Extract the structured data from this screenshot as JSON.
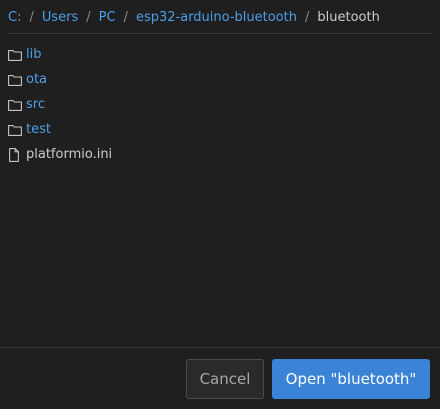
{
  "breadcrumb": {
    "segments": [
      {
        "label": "C:"
      },
      {
        "label": "Users"
      },
      {
        "label": "PC"
      },
      {
        "label": "esp32-arduino-bluetooth"
      },
      {
        "label": "bluetooth"
      }
    ],
    "separator": "/"
  },
  "entries": [
    {
      "name": "lib",
      "type": "folder"
    },
    {
      "name": "ota",
      "type": "folder"
    },
    {
      "name": "src",
      "type": "folder"
    },
    {
      "name": "test",
      "type": "folder"
    },
    {
      "name": "platformio.ini",
      "type": "file"
    }
  ],
  "footer": {
    "cancel_label": "Cancel",
    "open_label": "Open \"bluetooth\""
  },
  "colors": {
    "link": "#4d9ee8",
    "primary_button": "#3a83d6",
    "background": "#1f1f1f"
  }
}
